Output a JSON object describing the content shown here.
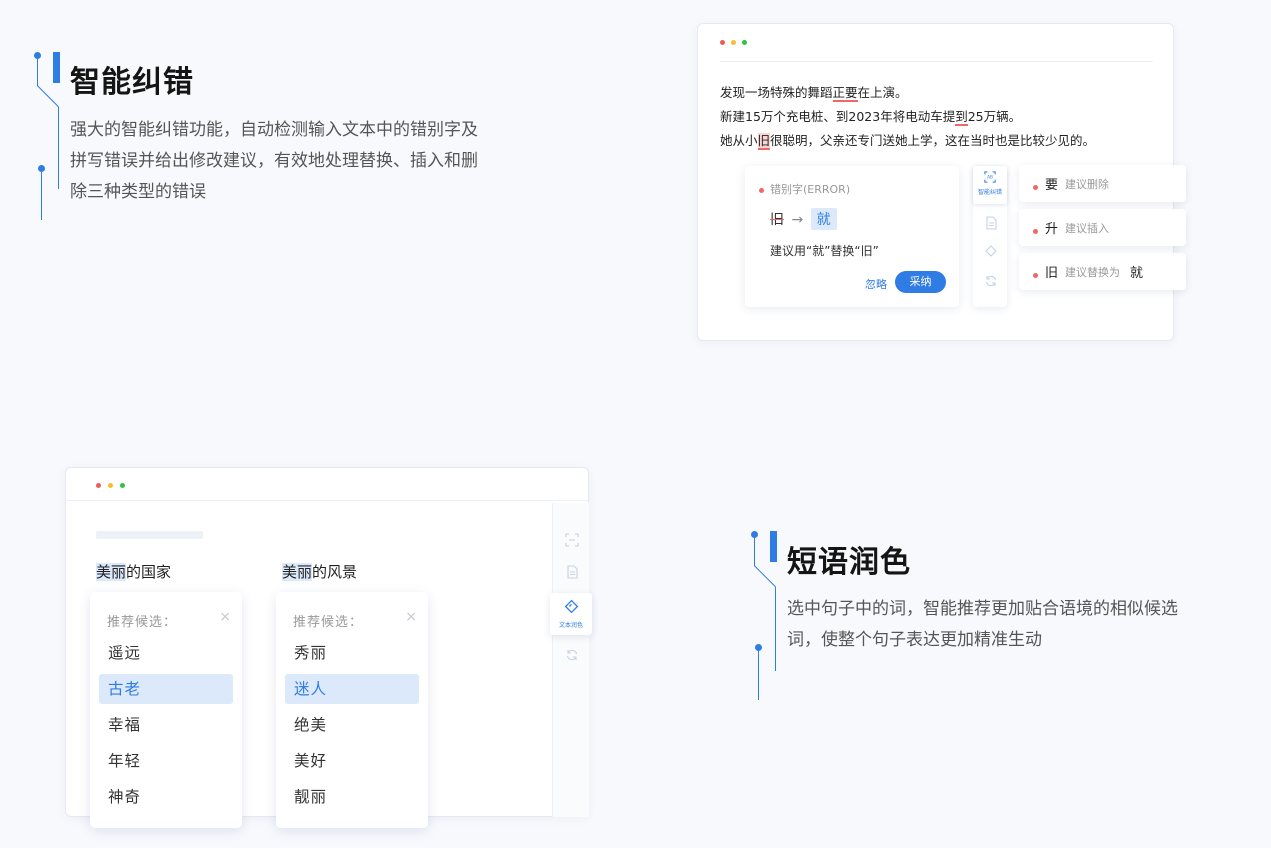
{
  "section1": {
    "title": "智能纠错",
    "desc_lines": [
      "强大的智能纠错功能，自动检测输入文本中的错别字及",
      "拼写错误并给出修改建议，有效地处理替换、插入和删",
      "除三种类型的错误"
    ]
  },
  "section2": {
    "title": "短语润色",
    "desc_lines": [
      "选中句子中的词，智能推荐更加贴合语境的相似候选",
      "词，使整个句子表达更加精准生动"
    ]
  },
  "window1": {
    "sentences": [
      {
        "before": "发现一场特殊的舞蹈",
        "mark": "正要",
        "after": "在上演。"
      },
      {
        "before": "新建15万个充电桩、到2023年将电动车提",
        "mark": "到",
        "after": "25万辆。"
      },
      {
        "before": "她从小",
        "mark": "旧",
        "after": "很聪明，父亲还专门送她上学，这在当时也是比较少见的。"
      }
    ],
    "error_card": {
      "label": "错别字(ERROR)",
      "wrong": "旧",
      "arrow": "→",
      "right": "就",
      "suggestion": "建议用“就”替换“旧”",
      "ignore": "忽略",
      "accept": "采纳"
    },
    "tool_label": "智能纠错",
    "suggestions": [
      {
        "word": "要",
        "hint": "建议删除",
        "target": ""
      },
      {
        "word": "升",
        "hint": "建议插入",
        "target": ""
      },
      {
        "word": "旧",
        "hint": "建议替换为",
        "target": "就"
      }
    ]
  },
  "window2": {
    "tool_label": "文本润色",
    "columns": [
      {
        "highlight": "美丽",
        "rest": "的国家",
        "header": "推荐候选：",
        "close": "×",
        "items": [
          "遥远",
          "古老",
          "幸福",
          "年轻",
          "神奇"
        ],
        "selected": 1
      },
      {
        "highlight": "美丽",
        "rest": "的风景",
        "header": "推荐候选：",
        "close": "×",
        "items": [
          "秀丽",
          "迷人",
          "绝美",
          "美好",
          "靓丽"
        ],
        "selected": 1
      }
    ]
  },
  "colors": {
    "accent": "#2f7ce4",
    "error": "#f06767",
    "highlight": "#dbe9fb"
  },
  "icons": [
    "scan-icon",
    "document-icon",
    "diamond-icon",
    "refresh-icon"
  ]
}
